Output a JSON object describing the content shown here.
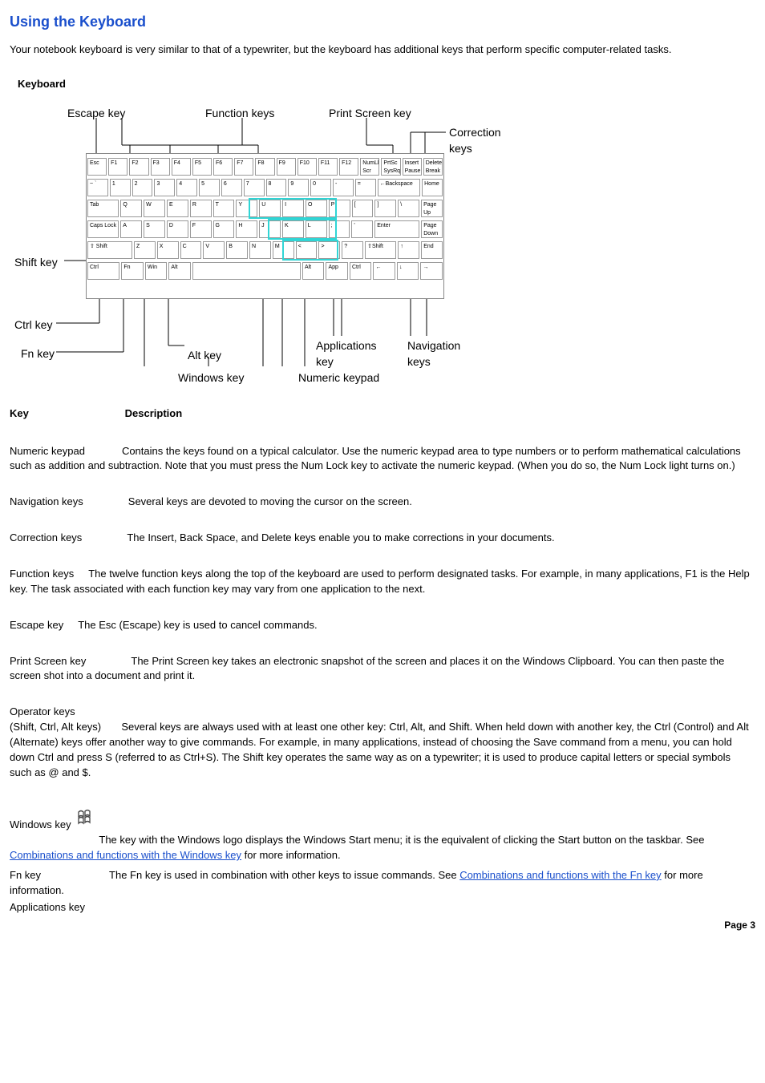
{
  "title": "Using the Keyboard",
  "intro": "Your notebook keyboard is very similar to that of a typewriter, but the keyboard has additional keys that perform specific computer-related tasks.",
  "figure": {
    "caption": "Keyboard",
    "callouts": {
      "escape": "Escape key",
      "function": "Function keys",
      "printscreen": "Print Screen key",
      "correction": "Correction\nkeys",
      "shift": "Shift key",
      "ctrl": "Ctrl key",
      "fn": "Fn key",
      "alt": "Alt key",
      "windows": "Windows key",
      "numeric": "Numeric keypad",
      "applications": "Applications\nkey",
      "navigation": "Navigation\nkeys"
    },
    "keycaps": {
      "r1": [
        "Esc",
        "F1",
        "F2",
        "F3",
        "F4",
        "F5",
        "F6",
        "F7",
        "F8",
        "F9",
        "F10",
        "F11",
        "F12",
        "NumLk\nScr Lk",
        "PrtSc\nSysRq",
        "Insert\nPause",
        "Delete\nBreak"
      ],
      "r2": [
        "~\n`",
        "1",
        "2",
        "3",
        "4",
        "5",
        "6",
        "7",
        "8",
        "9",
        "0",
        "-",
        "=",
        "←Backspace",
        "Home"
      ],
      "r3": [
        "Tab",
        "Q",
        "W",
        "E",
        "R",
        "T",
        "Y",
        "U",
        "I",
        "O",
        "P",
        "[",
        "]",
        "\\",
        "Page\nUp"
      ],
      "r4": [
        "Caps Lock",
        "A",
        "S",
        "D",
        "F",
        "G",
        "H",
        "J",
        "K",
        "L",
        ";",
        "'",
        "Enter",
        "Page\nDown"
      ],
      "r5": [
        "⇧ Shift",
        "Z",
        "X",
        "C",
        "V",
        "B",
        "N",
        "M",
        "<",
        ">",
        "?",
        "⇧Shift",
        "↑",
        "End"
      ],
      "r6": [
        "Ctrl",
        "Fn",
        "Win",
        "Alt",
        " ",
        "Alt",
        "App",
        "Ctrl",
        "←",
        "↓",
        "→"
      ]
    }
  },
  "table": {
    "head_key": "Key",
    "head_desc": "Description",
    "rows": [
      {
        "id": "numeric",
        "term": "Numeric keypad",
        "desc": "Contains the keys found on a typical calculator. Use the numeric keypad area to type numbers or to perform mathematical calculations such as addition and subtraction. Note that you must press the Num Lock key to activate the numeric keypad. (When you do so, the Num Lock light turns on.)",
        "gap": "md"
      },
      {
        "id": "navigation",
        "term": "Navigation keys",
        "desc": "Several keys are devoted to moving the cursor on the screen.",
        "gap": "lg"
      },
      {
        "id": "correction",
        "term": "Correction keys",
        "desc": "The Insert, Back Space, and Delete keys enable you to make corrections in your documents.",
        "gap": "lg"
      },
      {
        "id": "function",
        "term": "Function keys",
        "desc": "The twelve function keys along the top of the keyboard are used to perform designated tasks. For example, in many applications, F1 is the Help key. The task associated with each function key may vary from one application to the next.",
        "gap": "sm"
      },
      {
        "id": "escape",
        "term": "Escape key",
        "desc": "The Esc (Escape) key is used to cancel commands.",
        "gap": "sm"
      },
      {
        "id": "printscreen",
        "term": "Print Screen key",
        "desc": "The Print Screen key takes an electronic snapshot of the screen and places it on the Windows Clipboard. You can then paste the screen shot into a document and print it.",
        "gap": "lg"
      }
    ],
    "operator": {
      "term": "Operator keys",
      "sub": "(Shift, Ctrl, Alt keys)",
      "desc": "Several keys are always used with at least one other key: Ctrl, Alt, and Shift. When held down with another key, the Ctrl (Control) and Alt (Alternate) keys offer another way to give commands. For example, in many applications, instead of choosing the Save command from a menu, you can hold down Ctrl and press S (referred to as Ctrl+S). The Shift key operates the same way as on a typewriter; it is used to produce capital letters or special symbols such as @ and $."
    },
    "windows": {
      "term": "Windows key",
      "desc_before_link": "The key with the Windows logo displays the Windows Start menu; it is the equivalent of clicking the Start button on the taskbar. See ",
      "link_text": "Combinations and functions with the Windows key",
      "desc_after_link": " for more information."
    },
    "fn": {
      "term": "Fn key",
      "desc_before_link": "The Fn key is used in combination with other keys to issue commands. See ",
      "link_text": "Combinations and functions with the Fn key",
      "desc_after_link": " for more information."
    },
    "applications": {
      "term": "Applications key"
    }
  },
  "page_number": "Page 3"
}
